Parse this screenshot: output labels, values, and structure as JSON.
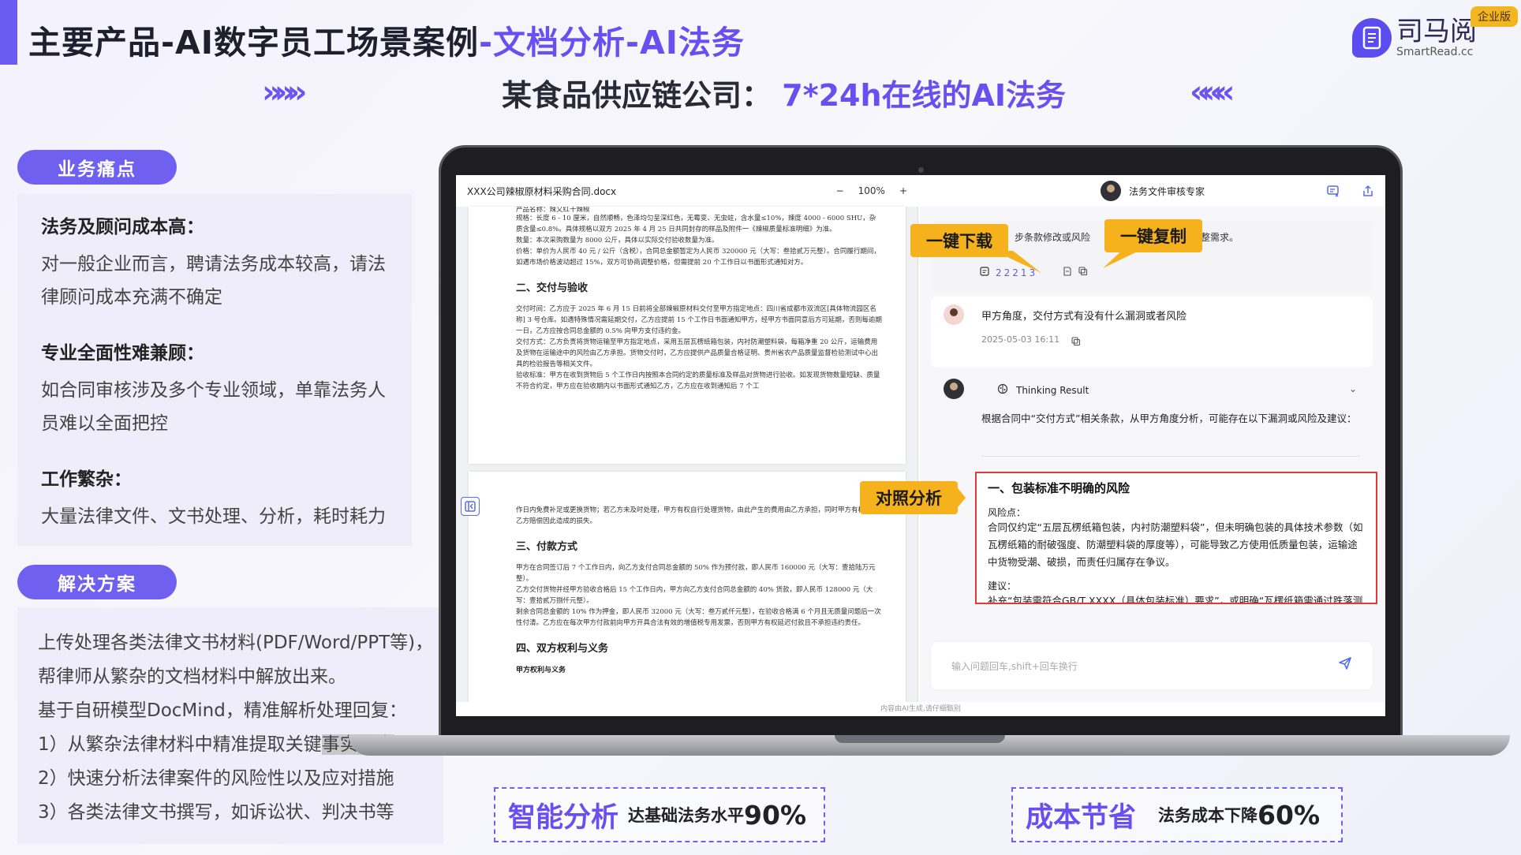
{
  "header": {
    "title_main": "主要产品-AI数字员工场景案例",
    "title_highlight": "-文档分析-AI法务",
    "logo_cn": "司马阅",
    "logo_en": "SmartRead.cc",
    "badge": "企业版",
    "subtitle_main": "某食品供应链公司：",
    "subtitle_highlight": "7*24h在线的AI法务",
    "arrows_left": "»»»",
    "arrows_right": "«««"
  },
  "pain": {
    "label": "业务痛点",
    "items": [
      {
        "head": "法务及顾问成本高：",
        "body": "对一般企业而言，聘请法务成本较高，请法律顾问成本充满不确定"
      },
      {
        "head": "专业全面性难兼顾：",
        "body": "如合同审核涉及多个专业领域，单靠法务人员难以全面把控"
      },
      {
        "head": "工作繁杂：",
        "body": "大量法律文件、文书处理、分析，耗时耗力"
      }
    ]
  },
  "solution": {
    "label": "解决方案",
    "lines": [
      "上传处理各类法律文书材料(PDF/Word/PPT等)，",
      "帮律师从繁杂的文档材料中解放出来。",
      "基于自研模型DocMind，精准解析处理回复：",
      "1）从繁杂法律材料中精准提取关键",
      "事实信息",
      "2）快速分析法律案件的风险性以及应对措施",
      "3）各类法律文书撰写，如诉讼状、判决书等"
    ]
  },
  "doc": {
    "filename": "XXX公司辣椒原材料采购合同.docx",
    "zoom": "100%",
    "minus": "−",
    "plus": "+",
    "page1_top": "产品名称：辣又红干辣椒",
    "page1_para1": "规格：长度 6 - 10 厘米，自然顺畅，色泽均匀呈深红色，无霉变、无虫蛀，含水量≤10%，辣度 4000 - 6000 SHU，杂质含量≤0.8%。具体规格以双方 2025 年 4 月 25 日共同封存的样品及附件一《辣椒质量标准明细》为准。",
    "page1_para2": "数量：本次采购数量为 8000 公斤，具体以实际交付验收数量为准。",
    "page1_para3": "价格：单价为人民币 40 元 / 公斤（含税），合同总金额暂定为人民币 320000 元（大写：叁拾贰万元整）。合同履行期间，如遇市场价格波动超过 15%，双方可协商调整价格，但需提前 20 个工作日以书面形式通知对方。",
    "page1_h": "二、交付与验收",
    "page1_para4": "交付时间：乙方应于 2025 年 6 月 15 日前将全部辣椒原材料交付至甲方指定地点：四川省成都市双流区[具体物流园区名称] 3 号仓库。如遇特殊情况需延期交付，乙方应提前 15 个工作日书面通知甲方，经甲方书面同意后方可延期，否则每逾期一日，乙方应按合同总金额的 0.5% 向甲方支付违约金。",
    "page1_para5": "交付方式：乙方负责将货物运输至甲方指定地点，采用五层瓦楞纸箱包装，内衬防潮塑料袋，每箱净重 20 公斤，运输费用及货物在运输途中的风险由乙方承担。货物交付时，乙方应提供产品质量合格证明、贵州省农产品质量监督检验测试中心出具的检验报告等相关文件。",
    "page1_para6": "验收标准：甲方在收到货物后 5 个工作日内按照本合同约定的质量标准及样品对货物进行验收。如发现货物数量短缺、质量不符合约定，甲方应在验收期内以书面形式通知乙方，乙方应在收到通知后 7 个工",
    "page2_para1": "作日内免费补足或更换货物；若乙方未及时处理，甲方有权自行处理货物，由此产生的费用由乙方承担，同时甲方有权要求乙方赔偿因此造成的损失。",
    "page2_h": "三、付款方式",
    "page2_para2": "甲方在合同签订后 7 个工作日内，向乙方支付合同总金额的 50% 作为预付款，即人民币 160000 元（大写：壹拾陆万元整）。",
    "page2_para3": "乙方交付货物并经甲方验收合格后 15 个工作日内，甲方向乙方支付合同总金额的 40% 货款，即人民币 128000 元（大写：壹拾贰万捌仟元整）。",
    "page2_para4": "剩余合同总金额的 10% 作为押金，即人民币 32000 元（大写：叁万贰仟元整），在验收合格满 6 个月且无质量问题后一次性付清。乙方应在每次甲方付款前向甲方开具合法有效的增值税专用发票，否则甲方有权延迟付款且不承担违约责任。",
    "page2_h2": "四、双方权利与义务",
    "page2_small": "甲方权利与义务"
  },
  "chat": {
    "expert": "法务文件审核专家",
    "msg1_text": "步条款修改或风险",
    "msg1_text2": "整需求。",
    "msg1_meta": "22213",
    "user_question": "甲方角度，交付方式有没有什么漏洞或者风险",
    "user_time": "2025-05-03 16:11",
    "thinking": "Thinking Result",
    "chevron": "⌄",
    "reply_intro": "根据合同中“交付方式”相关条款，从甲方角度分析，可能存在以下漏洞或风险及建议：",
    "risk_title": "一、包装标准不明确的风险",
    "risk_label": "风险点：",
    "risk_body": "合同仅约定“五层瓦楞纸箱包装，内衬防潮塑料袋”，但未明确包装的具体技术参数（如瓦楞纸箱的耐破强度、防潮塑料袋的厚度等），可能导致乙方使用低质量包装，运输途中货物受潮、破损，而责任归属存在争议。",
    "advice_label": "建议：",
    "advice_body": "补充“包装需符合GB/T XXXX（具体包装标准）要求”，或明确“瓦楞纸箱需通过跌落测试（跌落高度≥1.2米，无破损）”等具体指标，并附包装样品作为合同附",
    "input_placeholder": "输入问题回车,shift+回车换行",
    "footer": "内容由AI生成,请仔细甄别"
  },
  "tags": {
    "download": "一键下载",
    "copy": "一键复制",
    "compare": "对照分析"
  },
  "stats": [
    {
      "big": "智能分析",
      "small": "达基础法务水平",
      "num": "90%"
    },
    {
      "big": "成本节省",
      "small": "法务成本下降",
      "num": "60%"
    }
  ],
  "colors": {
    "accent": "#6a4ff0",
    "tag": "#f6b21d",
    "risk_border": "#e23a3a"
  }
}
